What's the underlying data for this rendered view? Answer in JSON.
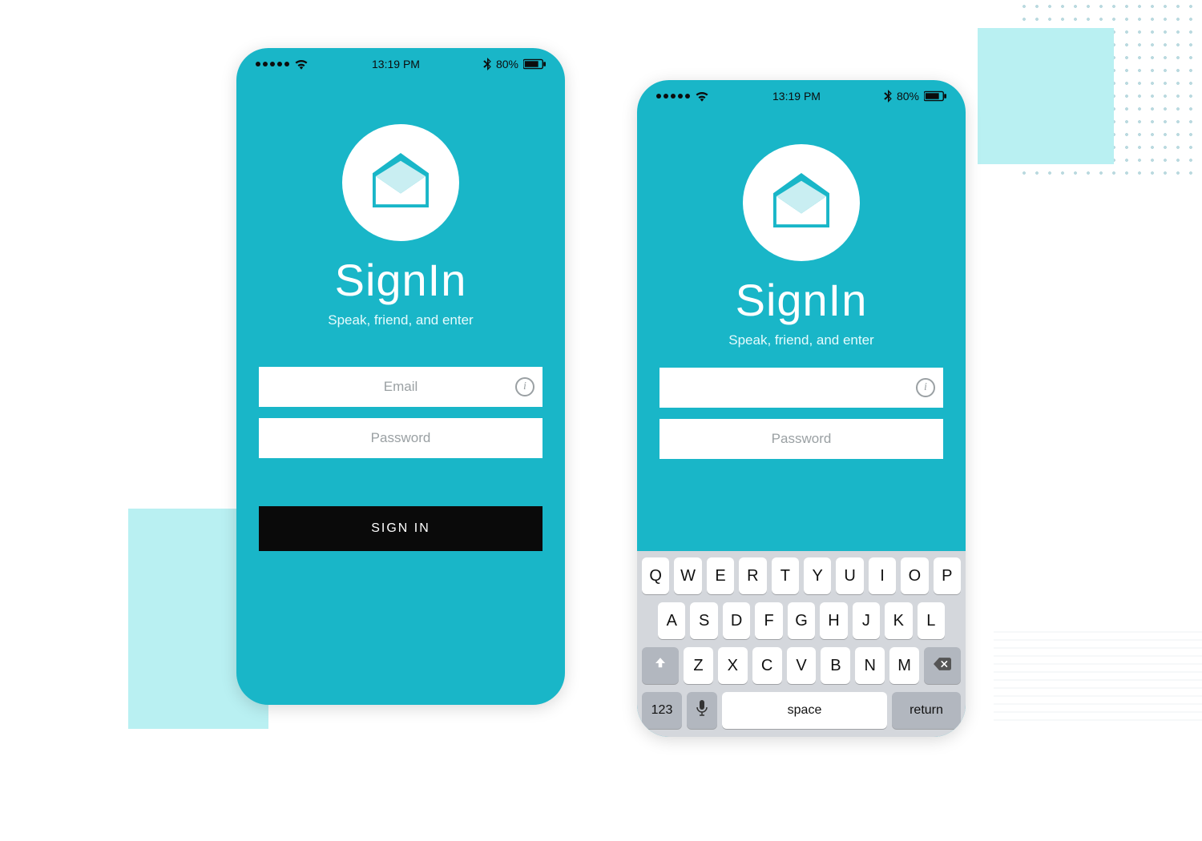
{
  "status_bar": {
    "time": "13:19 PM",
    "battery_pct": "80%"
  },
  "app": {
    "title": "SignIn",
    "subtitle": "Speak, friend, and enter"
  },
  "fields": {
    "email_placeholder": "Email",
    "password_placeholder": "Password",
    "info_glyph": "i"
  },
  "cta": {
    "signin_label": "SIGN IN"
  },
  "keyboard": {
    "row1": [
      "Q",
      "W",
      "E",
      "R",
      "T",
      "Y",
      "U",
      "I",
      "O",
      "P"
    ],
    "row2": [
      "A",
      "S",
      "D",
      "F",
      "G",
      "H",
      "J",
      "K",
      "L"
    ],
    "row3": [
      "Z",
      "X",
      "C",
      "V",
      "B",
      "N",
      "M"
    ],
    "nums_label": "123",
    "space_label": "space",
    "return_label": "return"
  },
  "colors": {
    "brand": "#19b6c8",
    "accent_light": "#b9f0f2",
    "cta_bg": "#0a0a0a"
  }
}
